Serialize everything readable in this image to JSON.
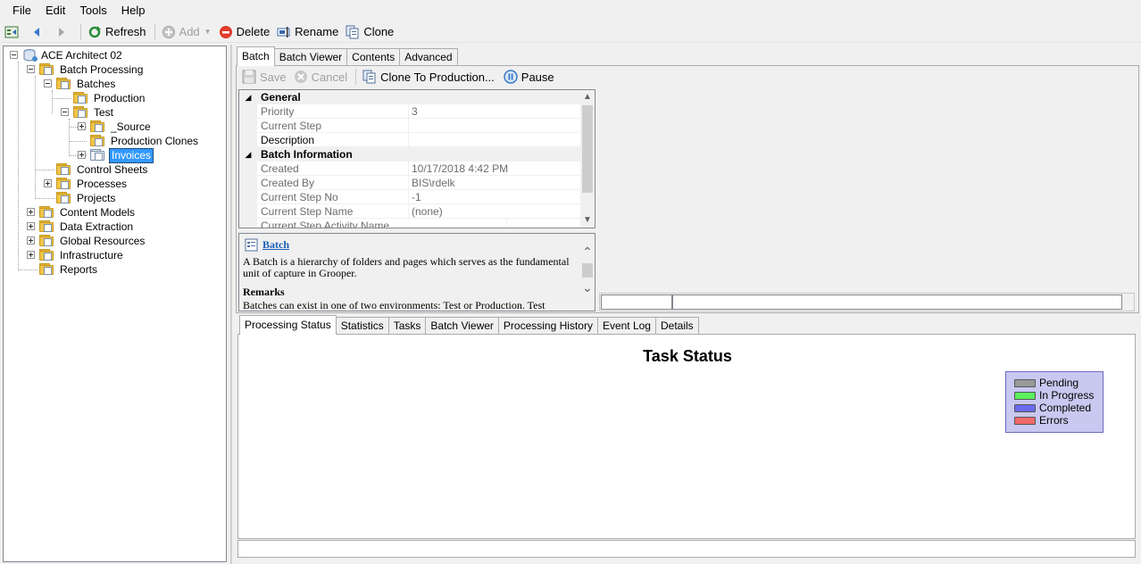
{
  "menu": [
    "File",
    "Edit",
    "Tools",
    "Help"
  ],
  "toolbar": {
    "refresh": "Refresh",
    "add": "Add",
    "delete": "Delete",
    "rename": "Rename",
    "clone": "Clone"
  },
  "tree": {
    "root": "ACE Architect 02",
    "batch_processing": "Batch Processing",
    "batches": "Batches",
    "production": "Production",
    "test": "Test",
    "source": "_Source",
    "production_clones": "Production Clones",
    "invoices": "Invoices",
    "control_sheets": "Control Sheets",
    "processes": "Processes",
    "projects": "Projects",
    "content_models": "Content Models",
    "data_extraction": "Data Extraction",
    "global_resources": "Global Resources",
    "infrastructure": "Infrastructure",
    "reports": "Reports"
  },
  "top_tabs": [
    "Batch",
    "Batch Viewer",
    "Contents",
    "Advanced"
  ],
  "batch_toolbar": {
    "save": "Save",
    "cancel": "Cancel",
    "clone_to_production": "Clone To Production...",
    "pause": "Pause"
  },
  "property_grid": {
    "general": "General",
    "priority_label": "Priority",
    "priority_value": "3",
    "current_step_label": "Current Step",
    "current_step_value": "",
    "description_label": "Description",
    "description_value": "",
    "batch_info": "Batch Information",
    "created_label": "Created",
    "created_value": "10/17/2018 4:42 PM",
    "created_by_label": "Created By",
    "created_by_value": "BIS\\rdelk",
    "current_step_no_label": "Current Step No",
    "current_step_no_value": "-1",
    "current_step_name_label": "Current Step Name",
    "current_step_name_value": "(none)",
    "current_step_activity_label": "Current Step Activity Name"
  },
  "help": {
    "title": "Batch",
    "body": "A Batch is a hierarchy of folders and pages which serves as the fundamental unit of capture in Grooper.",
    "remarks_heading": "Remarks",
    "remarks_body": "Batches can exist in one of two environments: Test or Production.  Test"
  },
  "bottom_tabs": [
    "Processing Status",
    "Statistics",
    "Tasks",
    "Batch Viewer",
    "Processing History",
    "Event Log",
    "Details"
  ],
  "chart_data": {
    "type": "bar",
    "title": "Task Status",
    "series": [
      {
        "name": "Pending",
        "values": [],
        "color": "#9a9a9a"
      },
      {
        "name": "In Progress",
        "values": [],
        "color": "#5cf05c"
      },
      {
        "name": "Completed",
        "values": [],
        "color": "#6a6af0"
      },
      {
        "name": "Errors",
        "values": [],
        "color": "#f06a6a"
      }
    ],
    "legend_position": "top-right"
  }
}
